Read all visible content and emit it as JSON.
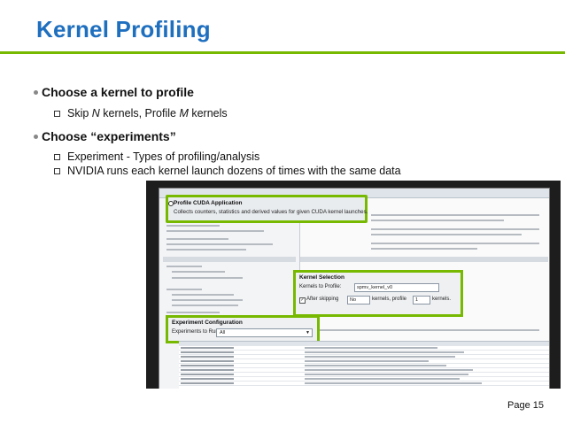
{
  "slide": {
    "title": "Kernel Profiling",
    "page_label": "Page 15"
  },
  "bullets": [
    {
      "text": "Choose a kernel to profile",
      "sub": [
        {
          "parts": [
            "Skip ",
            "N",
            " kernels, Profile ",
            "M",
            " kernels"
          ]
        }
      ]
    },
    {
      "text": "Choose “experiments”",
      "sub": [
        {
          "parts": [
            "Experiment - Types of profiling/analysis"
          ]
        },
        {
          "parts": [
            "NVIDIA runs each kernel launch dozens of times with the same data"
          ]
        }
      ]
    }
  ],
  "screenshot": {
    "profile_callout": {
      "heading": "Profile CUDA Application",
      "description": "Collects counters, statistics and derived values for given CUDA kernel launches."
    },
    "kernel_selection": {
      "heading": "Kernel Selection",
      "kernels_to_profile_label": "Kernels to Profile:",
      "kernel_name_value": "spmv_kernel_v0",
      "after_skipping_label": "After skipping",
      "skip_value": "No",
      "kernels_profile_label": "kernels, profile",
      "profile_count_value": "1",
      "kernels_label": "kernels."
    },
    "experiment_config": {
      "heading": "Experiment Configuration",
      "experiments_label": "Experiments to Run:",
      "experiments_value": "All"
    }
  },
  "colors": {
    "title": "#1f6fbf",
    "accent_green": "#76b900",
    "screenshot_frame": "#1d1d1d"
  }
}
